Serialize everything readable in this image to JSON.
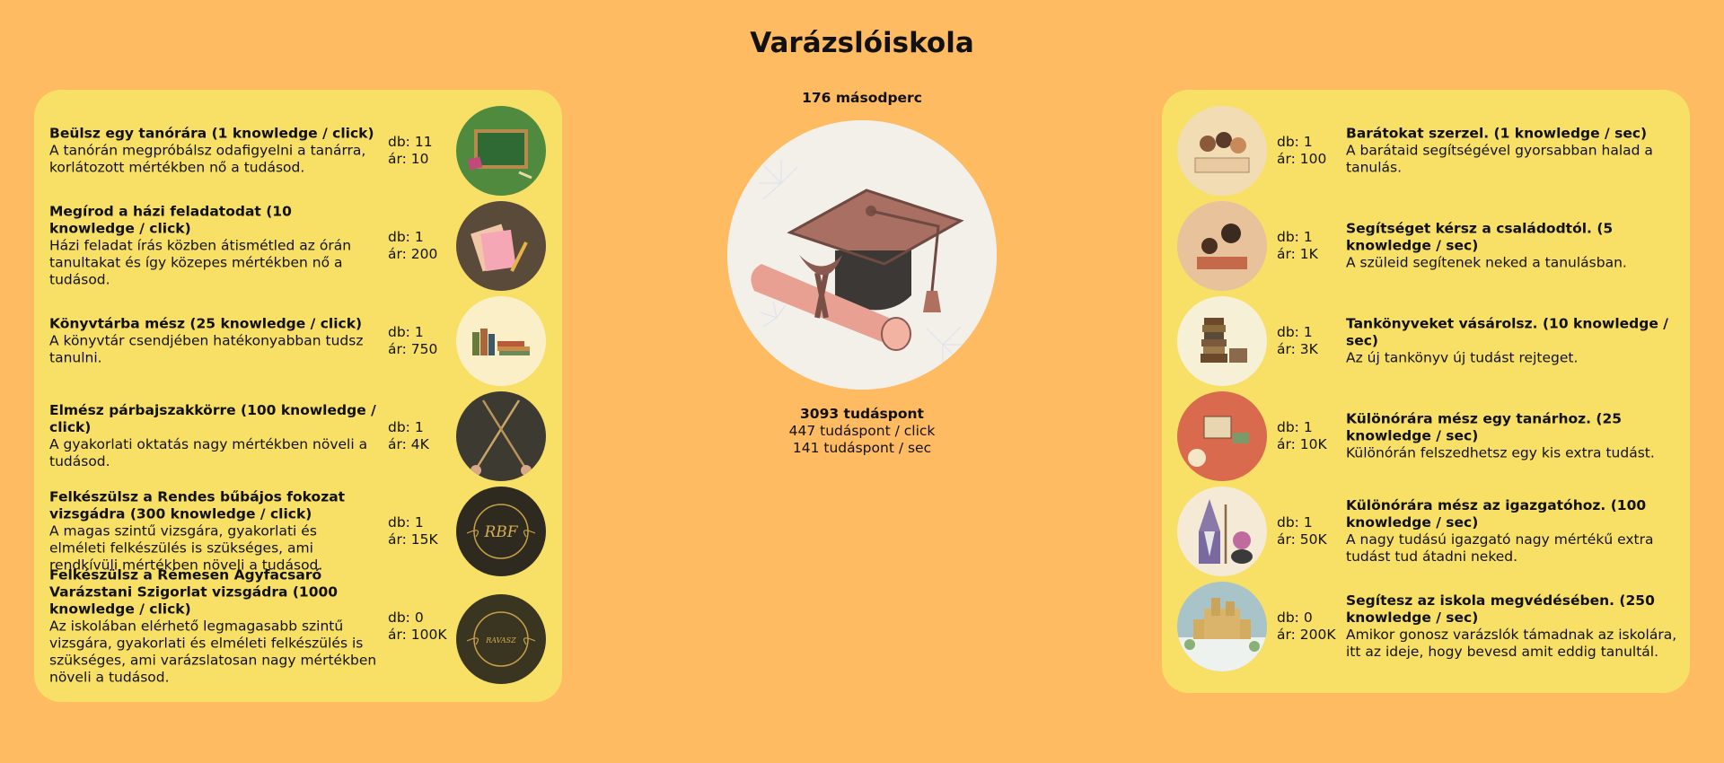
{
  "title": "Varázslóiskola",
  "timer": "176 másodperc",
  "score": {
    "points": "3093 tudáspont",
    "per_click": "447 tudáspont / click",
    "per_sec": "141 tudáspont / sec"
  },
  "click_upgrades": [
    {
      "name": "Beülsz egy tanórára (1 knowledge / click)",
      "desc": "A tanórán megpróbálsz odafigyelni a tanárra, korlátozott mértékben nő a tudásod.",
      "count": "db: 11",
      "price": "ár: 10",
      "icon": "chalkboard-icon"
    },
    {
      "name": "Megírod a házi feladatodat (10 knowledge / click)",
      "desc": "Házi feladat írás közben átismétled az órán tanultakat és így közepes mértékben nő a tudásod.",
      "count": "db: 1",
      "price": "ár: 200",
      "icon": "notebooks-icon"
    },
    {
      "name": "Könyvtárba mész (25 knowledge / click)",
      "desc": "A könyvtár csendjében hatékonyabban tudsz tanulni.",
      "count": "db: 1",
      "price": "ár: 750",
      "icon": "books-icon"
    },
    {
      "name": "Elmész párbajszakkörre (100 knowledge / click)",
      "desc": "A gyakorlati oktatás nagy mértékben növeli a tudásod.",
      "count": "db: 1",
      "price": "ár: 4K",
      "icon": "wands-icon"
    },
    {
      "name": "Felkészülsz a Rendes bűbájos fokozat vizsgádra (300 knowledge / click)",
      "desc": "A magas szintű vizsgára, gyakorlati és elméleti felkészülés is szükséges, ami rendkívüli mértékben növeli a tudásod.",
      "count": "db: 1",
      "price": "ár: 15K",
      "icon": "rbf-badge-icon",
      "badge_text": "RBF"
    },
    {
      "name": "Felkészülsz a Rémesen Agyfacsaró Varázstani Szigorlat vizsgádra (1000 knowledge / click)",
      "desc": "Az iskolában elérhető legmagasabb szintű vizsgára, gyakorlati és elméleti felkészülés is szükséges, ami varázslatosan nagy mértékben növeli a tudásod.",
      "count": "db: 0",
      "price": "ár: 100K",
      "icon": "ravasz-badge-icon",
      "badge_text": "RAVASZ"
    }
  ],
  "sec_upgrades": [
    {
      "name": "Barátokat szerzel. (1 knowledge / sec)",
      "desc": "A barátaid segítségével gyorsabban halad a tanulás.",
      "count": "db: 1",
      "price": "ár: 100",
      "icon": "friends-icon"
    },
    {
      "name": "Segítséget kérsz a családodtól. (5 knowledge / sec)",
      "desc": "A szüleid segítenek neked a tanulásban.",
      "count": "db: 1",
      "price": "ár: 1K",
      "icon": "family-icon"
    },
    {
      "name": "Tankönyveket vásárolsz. (10 knowledge / sec)",
      "desc": "Az új tankönyv új tudást rejteget.",
      "count": "db: 1",
      "price": "ár: 3K",
      "icon": "textbooks-icon"
    },
    {
      "name": "Különórára mész egy tanárhoz. (25 knowledge / sec)",
      "desc": "Különórán felszedhetsz egy kis extra tudást.",
      "count": "db: 1",
      "price": "ár: 10K",
      "icon": "tutor-icon"
    },
    {
      "name": "Különórára mész az igazgatóhoz. (100 knowledge / sec)",
      "desc": "A nagy tudású igazgató nagy mértékű extra tudást tud átadni neked.",
      "count": "db: 1",
      "price": "ár: 50K",
      "icon": "wizard-icon"
    },
    {
      "name": "Segítesz az iskola megvédésében. (250 knowledge / sec)",
      "desc": "Amikor gonosz varázslók támadnak az iskolára, itt az ideje, hogy bevesd amit eddig tanultál.",
      "count": "db: 0",
      "price": "ár: 200K",
      "icon": "castle-icon"
    }
  ],
  "main_icon": "graduation-cap-icon",
  "colors": {
    "background": "#ffbb62",
    "panel": "#f8e066"
  }
}
